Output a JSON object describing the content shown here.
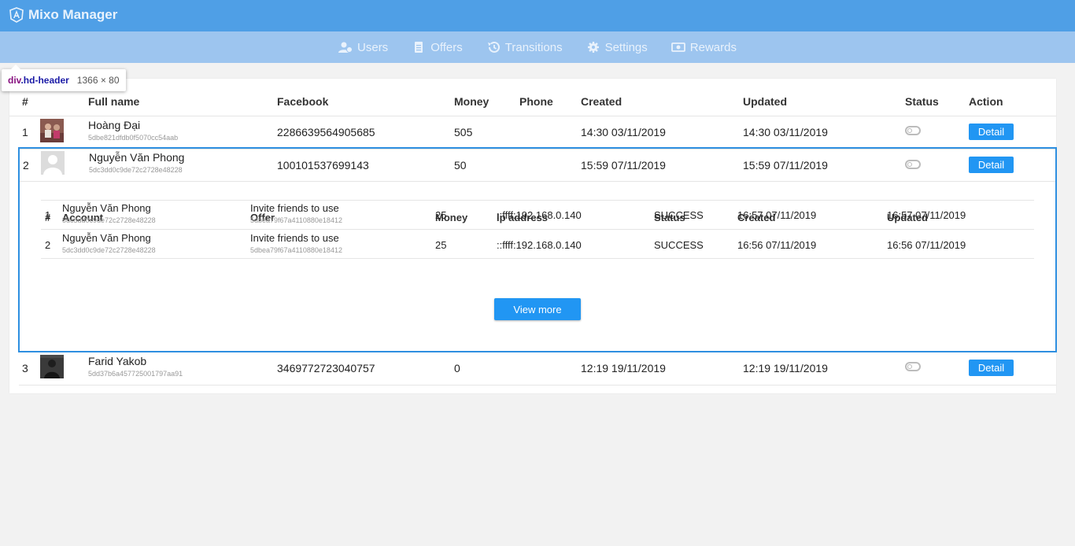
{
  "app": {
    "title": "Mixo Manager"
  },
  "nav": [
    {
      "label": "Users",
      "icon": "users-icon"
    },
    {
      "label": "Offers",
      "icon": "clipboard-icon"
    },
    {
      "label": "Transitions",
      "icon": "history-icon"
    },
    {
      "label": "Settings",
      "icon": "gear-icon"
    },
    {
      "label": "Rewards",
      "icon": "money-icon"
    }
  ],
  "inspector_tooltip": {
    "tag": "div",
    "class": ".hd-header",
    "size": "1366 × 80"
  },
  "users_table": {
    "headers": {
      "index": "#",
      "full_name": "Full name",
      "facebook": "Facebook",
      "money": "Money",
      "phone": "Phone",
      "created": "Created",
      "updated": "Updated",
      "status": "Status",
      "action": "Action"
    },
    "rows": [
      {
        "index": "1",
        "name": "Hoàng Đại",
        "id": "5dbe821dfdb0f5070cc54aab",
        "facebook": "2286639564905685",
        "money": "505",
        "phone": "",
        "created": "14:30 03/11/2019",
        "updated": "14:30 03/11/2019",
        "action": "Detail"
      },
      {
        "index": "2",
        "name": "Nguyễn Văn Phong",
        "id": "5dc3dd0c9de72c2728e48228",
        "facebook": "100101537699143",
        "money": "50",
        "phone": "",
        "created": "15:59 07/11/2019",
        "updated": "15:59 07/11/2019",
        "action": "Detail"
      },
      {
        "index": "3",
        "name": "Farid Yakob",
        "id": "5dd37b6a457725001797aa91",
        "facebook": "3469772723040757",
        "money": "0",
        "phone": "",
        "created": "12:19 19/11/2019",
        "updated": "12:19 19/11/2019",
        "action": "Detail"
      }
    ]
  },
  "transactions": {
    "headers": {
      "index": "#",
      "account": "Account",
      "offer": "Offer",
      "money": "Money",
      "ip": "Ip address",
      "status": "Status",
      "created": "Created",
      "updated": "Updated"
    },
    "rows": [
      {
        "index": "1",
        "account": "Nguyễn Văn Phong",
        "account_id": "5dc3dd0c9de72c2728e48228",
        "offer": "Invite friends to use",
        "offer_id": "5dbea79f67a4110880e18412",
        "money": "25",
        "ip": "::ffff:192.168.0.140",
        "status": "SUCCESS",
        "created": "16:57 07/11/2019",
        "updated": "16:57 07/11/2019"
      },
      {
        "index": "2",
        "account": "Nguyễn Văn Phong",
        "account_id": "5dc3dd0c9de72c2728e48228",
        "offer": "Invite friends to use",
        "offer_id": "5dbea79f67a4110880e18412",
        "money": "25",
        "ip": "::ffff:192.168.0.140",
        "status": "SUCCESS",
        "created": "16:56 07/11/2019",
        "updated": "16:56 07/11/2019"
      }
    ],
    "view_more": "View more"
  }
}
